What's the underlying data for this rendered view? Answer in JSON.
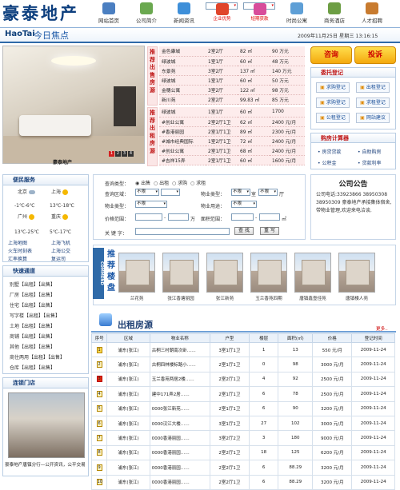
{
  "logo": "豪泰地产",
  "nav": [
    {
      "label": "网站首页",
      "color": "#4b7fc1"
    },
    {
      "label": "公司简介",
      "color": "#6aa84f"
    },
    {
      "label": "新闻资讯",
      "color": "#3e8fd9"
    },
    {
      "label": "企业优势",
      "color": "#e0452b"
    },
    {
      "label": "短期获款",
      "color": "#d84c9b"
    },
    {
      "label": "时尚公寓",
      "color": "#5e9fd6"
    },
    {
      "label": "商务酒店",
      "color": "#6d9e44"
    },
    {
      "label": "人才招聘",
      "color": "#c87b2f"
    }
  ],
  "header": {
    "brand": "HaoTai",
    "focus": "今日焦点",
    "date": "2009年11月25日 星期三 13:16:15"
  },
  "hero": {
    "caption": "豪泰地产",
    "pages": [
      "1",
      "2",
      "3",
      "4"
    ]
  },
  "sale": {
    "label": "推荐出售房源",
    "rows": [
      [
        "金色康城",
        "2室2厅",
        "82 ㎡",
        "90 万元"
      ],
      [
        "绿波城",
        "1室1厅",
        "60 ㎡",
        "48 万元"
      ],
      [
        "东景苑",
        "3室2厅",
        "137 ㎡",
        "140 万元"
      ],
      [
        "绿波城",
        "1室1厅",
        "60 ㎡",
        "50 万元"
      ],
      [
        "金穗公寓",
        "3室2厅",
        "122 ㎡",
        "98 万元"
      ],
      [
        "新川苑",
        "2室2厅",
        "99.83 ㎡",
        "85 万元"
      ]
    ]
  },
  "rent": {
    "label": "推荐出租房源",
    "rows": [
      [
        "绿波城",
        "1室1厅",
        "60 ㎡",
        "1700"
      ],
      [
        "#创业公寓",
        "2室2厅1卫",
        "62 ㎡",
        "2400 元/月"
      ],
      [
        "#香港丽园",
        "2室1厅1卫",
        "89 ㎡",
        "2300 元/月"
      ],
      [
        "#城市经典国际",
        "1室2厅1卫",
        "72 ㎡",
        "2400 元/月"
      ],
      [
        "#创业公寓",
        "2室1厅1卫",
        "68 ㎡",
        "2400 元/月"
      ],
      [
        "#吉祥15弄",
        "2室1厅1卫",
        "60 ㎡",
        "1600 元/月"
      ]
    ]
  },
  "quick": {
    "consult": "咨询",
    "complaint": "投诉"
  },
  "delegate": {
    "title": "委托登记",
    "buttons": [
      "求购登记",
      "出租登记",
      "求购登记",
      "求租登记",
      "公租登记",
      "网站建议"
    ]
  },
  "calc": {
    "title": "购房计算器",
    "links": [
      "房贷贷款",
      "自助购房",
      "公积金",
      "贷款利率"
    ]
  },
  "service": {
    "title": "便民服务",
    "cities": [
      {
        "name": "北京",
        "temp": "-1℃-6℃"
      },
      {
        "name": "上海",
        "temp": "13℃-18℃"
      },
      {
        "name": "广州",
        "temp": "13℃-25℃"
      },
      {
        "name": "重庆",
        "temp": "5℃-17℃"
      }
    ],
    "links": [
      "上海地图",
      "上海飞机",
      "火车时刻表",
      "上海公交",
      "汇率换算",
      "复运司"
    ]
  },
  "channel": {
    "title": "快速通道",
    "items": [
      "别墅【出租】【出售】",
      "厂房【出租】【出售】",
      "住宅【出租】【出售】",
      "写字楼【出租】【出售】",
      "土地【出租】【出售】",
      "商铺【出租】【出售】",
      "其他【出租】【出售】",
      "商住两用【出租】【出售】",
      "仓库【出租】【出售】"
    ]
  },
  "branch": {
    "title": "连锁门店",
    "caption": "豪泰地产唐镇分行—公开资讯，公平交易"
  },
  "search": {
    "type_label": "查询类型：",
    "types": [
      "出售",
      "出租",
      "求购",
      "求租"
    ],
    "area_label": "查询区域：",
    "area_val": "不限",
    "ptype_label": "物业类型：",
    "ptype_val": "不限",
    "arch_label": "物业类型：",
    "arch_val": "不限",
    "room_label": "室",
    "room_val": "不限",
    "hall_label": "厅",
    "use_label": "物业用途：",
    "use_val": "不限",
    "price_label": "价格范围：",
    "price_unit": "万",
    "areasize_label": "面积范围：",
    "areasize_unit": "㎡",
    "kw_label": "关 键 字：",
    "btn_search": "查 找",
    "btn_reset": "重 写"
  },
  "notice": {
    "title": "公司公告",
    "text": "公司电话:33923866 38950308 38950309 豪泰地产承接集体宿舍,带物业管理,欢迎来电洽谈."
  },
  "gallery": {
    "side": "COMMEND",
    "title": "推荐楼盘",
    "items": [
      "兰花苑",
      "张江香塘丽园",
      "张江新苑",
      "玉兰香苑四期",
      "唐镇鑫壹佳苑",
      "唐镇楼人苑"
    ]
  },
  "rent_list": {
    "title": "出租房源",
    "more": "更多..",
    "headers": [
      "序号",
      "区域",
      "物业名称",
      "户型",
      "楼层",
      "面积(㎡)",
      "价格",
      "登记时间"
    ],
    "rows": [
      [
        "1",
        "浦东(张江)",
        "古桐三村朝南次卧……",
        "3室1厅1卫",
        "1",
        "13",
        "550 元/月",
        "2009-11-24"
      ],
      [
        "2",
        "浦东(张江)",
        "古桐四林楼标路小……",
        "2室1厅1卫",
        "0",
        "98",
        "3000 元/月",
        "2009-11-24"
      ],
      [
        "3",
        "浦东(张江)",
        "玉兰香苑两居2楼……",
        "2室2厅1卫",
        "4",
        "92",
        "2500 元/月",
        "2009-11-24"
      ],
      [
        "4",
        "浦东(张江)",
        "建中171弄2居……",
        "2室1厅1卫",
        "6",
        "78",
        "2500 元/月",
        "2009-11-24"
      ],
      [
        "5",
        "浦东(张江)",
        "0000张江新苑……",
        "2室1厅1卫",
        "6",
        "90",
        "3200 元/月",
        "2009-11-24"
      ],
      [
        "6",
        "浦东(张江)",
        "0000汉江大楼……",
        "3室1厅1卫",
        "27",
        "102",
        "3000 元/月",
        "2009-11-24"
      ],
      [
        "7",
        "浦东(张江)",
        "0000香港丽园……",
        "3室2厅2卫",
        "3",
        "180",
        "9000 元/月",
        "2009-11-24"
      ],
      [
        "8",
        "浦东(张江)",
        "0000香港丽园……",
        "2室2厅1卫",
        "18",
        "125",
        "6200 元/月",
        "2009-11-24"
      ],
      [
        "9",
        "浦东(张江)",
        "0000香港丽园……",
        "2室2厅1卫",
        "6",
        "88.29",
        "3200 元/月",
        "2009-11-24"
      ],
      [
        "10",
        "浦东(张江)",
        "0000香港丽园……",
        "2室2厅1卫",
        "6",
        "88.29",
        "3200 元/月",
        "2009-11-24"
      ]
    ]
  }
}
